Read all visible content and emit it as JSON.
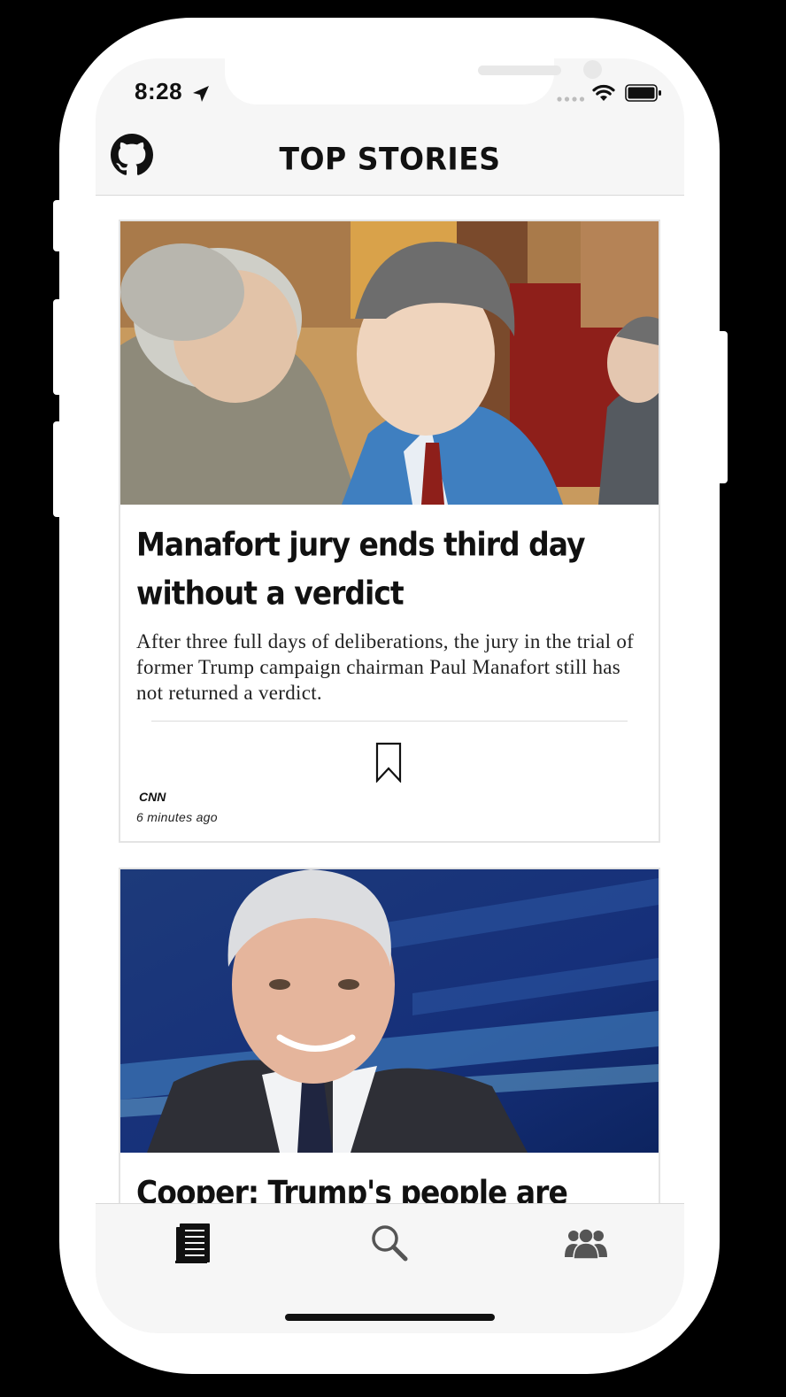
{
  "status_bar": {
    "time": "8:28"
  },
  "header": {
    "title": "TOP STORIES",
    "left_icon": "github-icon"
  },
  "articles": [
    {
      "title": "Manafort jury ends third day without a verdict",
      "description": "After three full days of deliberations, the jury in the trial of former Trump campaign chairman Paul Manafort still has not returned a verdict.",
      "source": "CNN",
      "time": "6 minutes ago",
      "image": "courtroom-sketch-image",
      "action_icon": "bookmark-icon"
    },
    {
      "title": "Cooper: Trump's people are assaulting",
      "image": "news-anchor-photo"
    }
  ],
  "tab_bar": {
    "items": [
      {
        "icon": "newspaper-icon",
        "active": true
      },
      {
        "icon": "search-icon",
        "active": false
      },
      {
        "icon": "people-icon",
        "active": false
      }
    ],
    "active_color": "#111111",
    "inactive_color": "#555555"
  },
  "colors": {
    "background": "#000000",
    "frame": "#ffffff",
    "bar": "#f6f6f6",
    "text": "#111111"
  }
}
